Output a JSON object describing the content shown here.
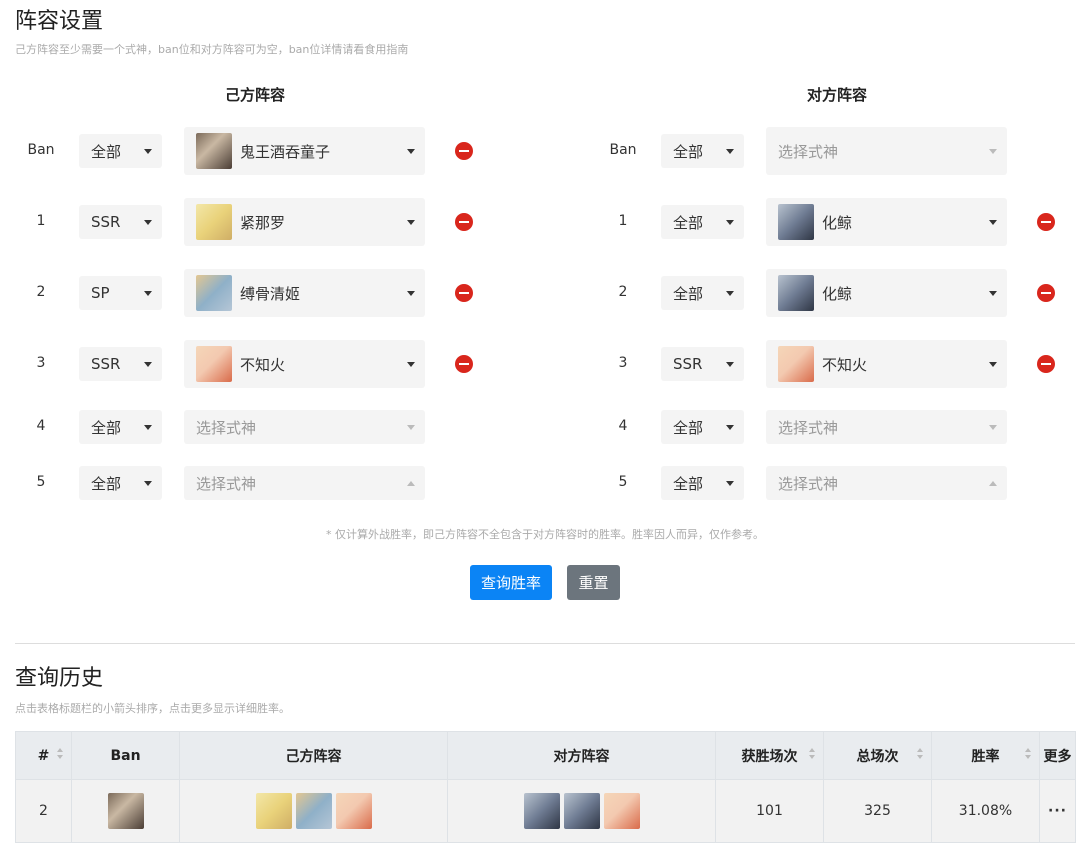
{
  "setup": {
    "title": "阵容设置",
    "hint": "己方阵容至少需要一个式神，ban位和对方阵容可为空，ban位详情请看食用指南",
    "own_header": "己方阵容",
    "opp_header": "对方阵容",
    "own_rows": [
      {
        "label": "Ban",
        "rarity": "全部",
        "shikigami": "鬼王酒吞童子",
        "avatar": "shuten-avatar",
        "removable": true
      },
      {
        "label": "1",
        "rarity": "SSR",
        "shikigami": "紧那罗",
        "avatar": "kinnara-avatar",
        "removable": true
      },
      {
        "label": "2",
        "rarity": "SP",
        "shikigami": "缚骨清姬",
        "avatar": "kiyohime-avatar",
        "removable": true
      },
      {
        "label": "3",
        "rarity": "SSR",
        "shikigami": "不知火",
        "avatar": "shiranui-avatar",
        "removable": true
      },
      {
        "label": "4",
        "rarity": "全部",
        "shikigami": "选择式神",
        "placeholder": true
      },
      {
        "label": "5",
        "rarity": "全部",
        "shikigami": "选择式神",
        "placeholder": true
      }
    ],
    "opp_rows": [
      {
        "label": "Ban",
        "rarity": "全部",
        "shikigami": "选择式神",
        "placeholder": true
      },
      {
        "label": "1",
        "rarity": "全部",
        "shikigami": "化鲸",
        "avatar": "huajing-avatar",
        "removable": true
      },
      {
        "label": "2",
        "rarity": "全部",
        "shikigami": "化鲸",
        "avatar": "huajing-avatar",
        "removable": true
      },
      {
        "label": "3",
        "rarity": "SSR",
        "shikigami": "不知火",
        "avatar": "shiranui-avatar",
        "removable": true
      },
      {
        "label": "4",
        "rarity": "全部",
        "shikigami": "选择式神",
        "placeholder": true
      },
      {
        "label": "5",
        "rarity": "全部",
        "shikigami": "选择式神",
        "placeholder": true
      }
    ],
    "footnote": "* 仅计算外战胜率，即己方阵容不全包含于对方阵容时的胜率。胜率因人而异，仅作参考。",
    "query_label": "查询胜率",
    "reset_label": "重置"
  },
  "history": {
    "title": "查询历史",
    "hint": "点击表格标题栏的小箭头排序，点击更多显示详细胜率。",
    "columns": [
      "#",
      "Ban",
      "己方阵容",
      "对方阵容",
      "获胜场次",
      "总场次",
      "胜率",
      "更多"
    ],
    "rows": [
      {
        "index": "2",
        "ban": [
          "shuten-avatar"
        ],
        "own": [
          "kinnara-avatar",
          "kiyohime-avatar",
          "shiranui-avatar"
        ],
        "opp": [
          "huajing-avatar",
          "huajing-avatar",
          "shiranui-avatar"
        ],
        "wins": "101",
        "total": "325",
        "rate": "31.08%",
        "more": "···"
      }
    ]
  },
  "colors": {
    "primary_button": "#0b84f5",
    "secondary_button": "#6c757d",
    "remove_icon": "#d9261c"
  }
}
